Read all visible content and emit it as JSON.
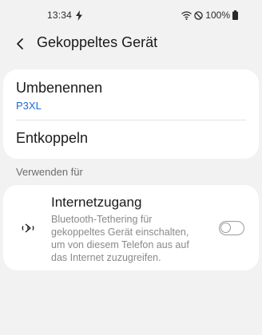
{
  "status_bar": {
    "time": "13:34",
    "battery": "100%"
  },
  "header": {
    "title": "Gekoppeltes Gerät"
  },
  "device_card": {
    "rename_label": "Umbenennen",
    "device_name": "P3XL",
    "unpair_label": "Entkoppeln"
  },
  "section": {
    "use_for_label": "Verwenden für"
  },
  "internet": {
    "title": "Internetzugang",
    "description": "Bluetooth-Tethering für\ngekoppeltes Gerät einschalten,\num von diesem Telefon aus auf\ndas Internet zuzugreifen.",
    "enabled": false
  },
  "colors": {
    "accent": "#1e6bd6",
    "background": "#f2f2f2",
    "card": "#ffffff"
  }
}
